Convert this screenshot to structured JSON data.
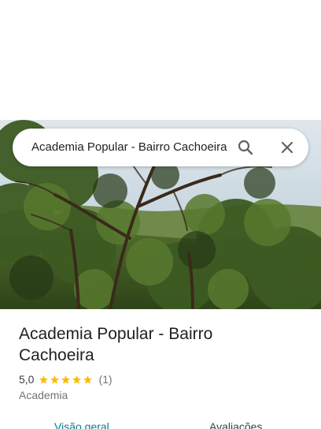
{
  "search": {
    "query": "Academia Popular - Bairro Cachoeira"
  },
  "place": {
    "title": "Academia Popular - Bairro Cachoeira",
    "rating": "5,0",
    "stars": 5,
    "review_count": "(1)",
    "category": "Academia"
  },
  "tabs": [
    {
      "label": "Visão geral",
      "selected": true
    },
    {
      "label": "Avaliações",
      "selected": false
    }
  ],
  "colors": {
    "star": "#fbbc04",
    "tab_selected": "#0b7a8a"
  },
  "icons": {
    "search": "search-icon",
    "close": "close-icon"
  }
}
